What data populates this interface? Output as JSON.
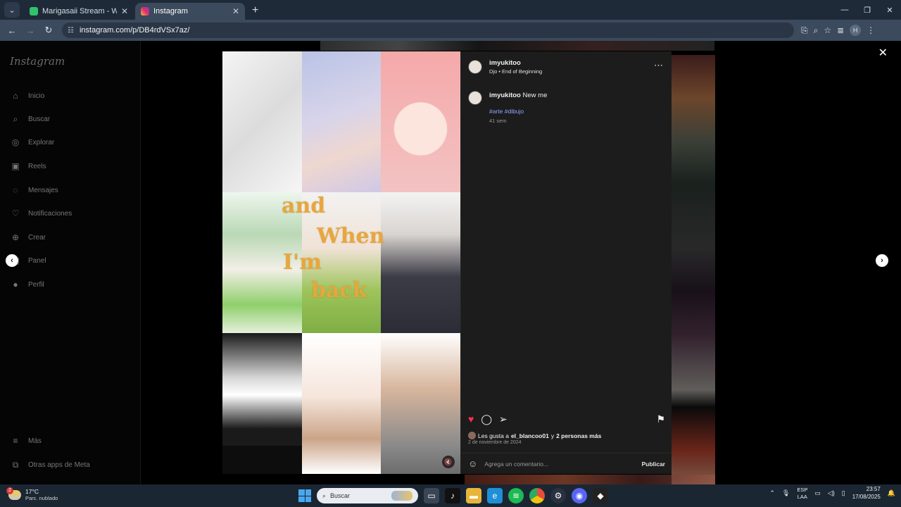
{
  "browser": {
    "tabs": [
      {
        "title": "Marigasaii Stream - Watch Live",
        "active": false,
        "color": "#31c16b"
      },
      {
        "title": "Instagram",
        "active": true,
        "color": "#e1306c"
      }
    ],
    "url": "instagram.com/p/DB4rdVSx7az/",
    "new_tab": "+",
    "window_controls": [
      "—",
      "❐",
      "✕"
    ]
  },
  "instagram": {
    "logo": "Instagram",
    "nav": [
      {
        "label": "Inicio",
        "icon": "home-icon",
        "glyph": "⌂"
      },
      {
        "label": "Buscar",
        "icon": "search-icon",
        "glyph": "⌕"
      },
      {
        "label": "Explorar",
        "icon": "compass-icon",
        "glyph": "◎"
      },
      {
        "label": "Reels",
        "icon": "reels-icon",
        "glyph": "▣"
      },
      {
        "label": "Mensajes",
        "icon": "messenger-icon",
        "glyph": "◌"
      },
      {
        "label": "Notificaciones",
        "icon": "heart-icon",
        "glyph": "♡"
      },
      {
        "label": "Crear",
        "icon": "plus-icon",
        "glyph": "⊕"
      },
      {
        "label": "Panel",
        "icon": "dashboard-icon",
        "glyph": "▥"
      },
      {
        "label": "Perfil",
        "icon": "profile-icon",
        "glyph": "●"
      }
    ],
    "nav_bottom": [
      {
        "label": "Más",
        "icon": "menu-icon",
        "glyph": "≡"
      },
      {
        "label": "Otras apps de Meta",
        "icon": "apps-icon",
        "glyph": "⧉"
      }
    ]
  },
  "post": {
    "username": "imyukitoo",
    "audio": "Djo • End of Beginning",
    "caption_user": "imyukitoo",
    "caption": "New me",
    "hashtags": "#arte #dibujo",
    "age": "41 sem",
    "likes_prefix": "Les gusta a ",
    "likes_user": "el_blancoo01",
    "likes_middle": " y ",
    "likes_others": "2 personas más",
    "date": "2 de noviembre de 2024",
    "comment_placeholder": "Agrega un comentario...",
    "publish_label": "Publicar",
    "overlay_text": [
      "and",
      "When",
      "I'm",
      "back"
    ],
    "accent_heart": "#ff3048",
    "hashtag_color": "#8fa6ff"
  },
  "taskbar": {
    "weather_temp": "17°C",
    "weather_desc": "Parc. nublado",
    "weather_badge": "2",
    "search_placeholder": "Buscar",
    "lang_1": "ESP",
    "lang_2": "LAA",
    "time": "23:57",
    "date": "17/08/2025"
  }
}
